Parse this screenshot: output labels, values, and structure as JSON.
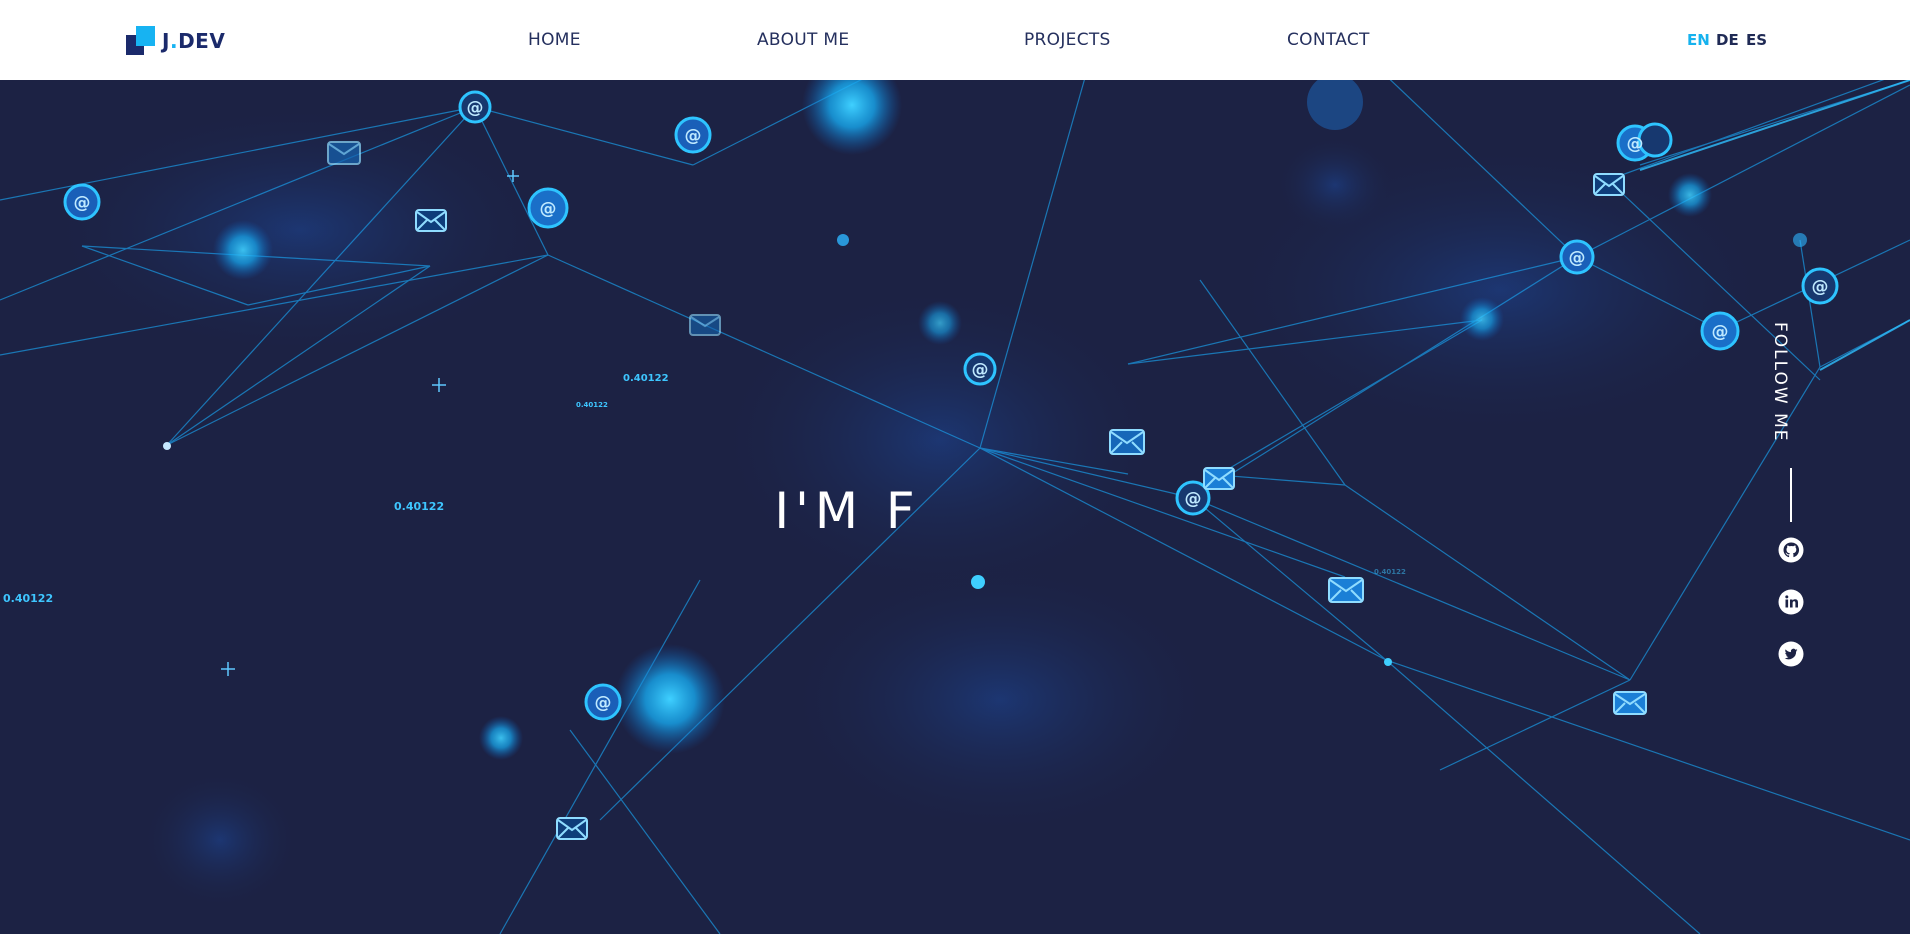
{
  "brand": {
    "name": "J",
    "dot": ".",
    "suffix": "DEV"
  },
  "nav": {
    "home": "HOME",
    "about": "ABOUT ME",
    "projects": "PROJECTS",
    "contact": "CONTACT"
  },
  "languages": {
    "en": "EN",
    "de": "DE",
    "es": "ES",
    "active": "EN"
  },
  "hero": {
    "title": "I'M F",
    "floating_numbers": [
      "0.40122",
      "0.40122",
      "0.40122",
      "0.40122",
      "0.40122"
    ]
  },
  "follow": {
    "label": "FOLLOW ME",
    "icons": [
      "github-icon",
      "linkedin-icon",
      "twitter-icon"
    ]
  },
  "colors": {
    "accent": "#16b2ee",
    "navy": "#1b2a6b",
    "background": "#1c2244"
  }
}
